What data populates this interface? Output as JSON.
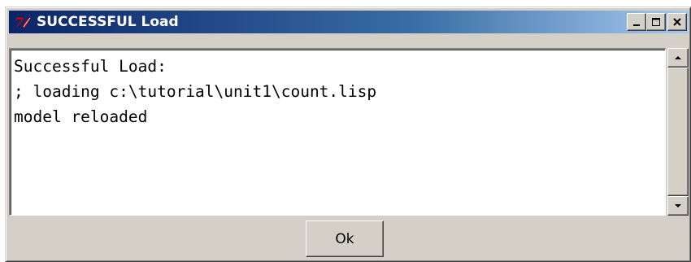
{
  "window": {
    "title": "SUCCESSFUL Load",
    "title_icon": "tk-feather-icon",
    "controls": [
      "minimize-icon",
      "maximize-icon",
      "close-icon"
    ]
  },
  "message": {
    "lines": [
      "Successful Load:",
      "; loading c:\\tutorial\\unit1\\count.lisp",
      "model reloaded"
    ]
  },
  "buttons": {
    "ok_label": "Ok"
  },
  "colors": {
    "titlebar_start": "#0a246a",
    "titlebar_end": "#a6caf0",
    "face": "#d4d0c8",
    "icon_red": "#cc0000"
  }
}
